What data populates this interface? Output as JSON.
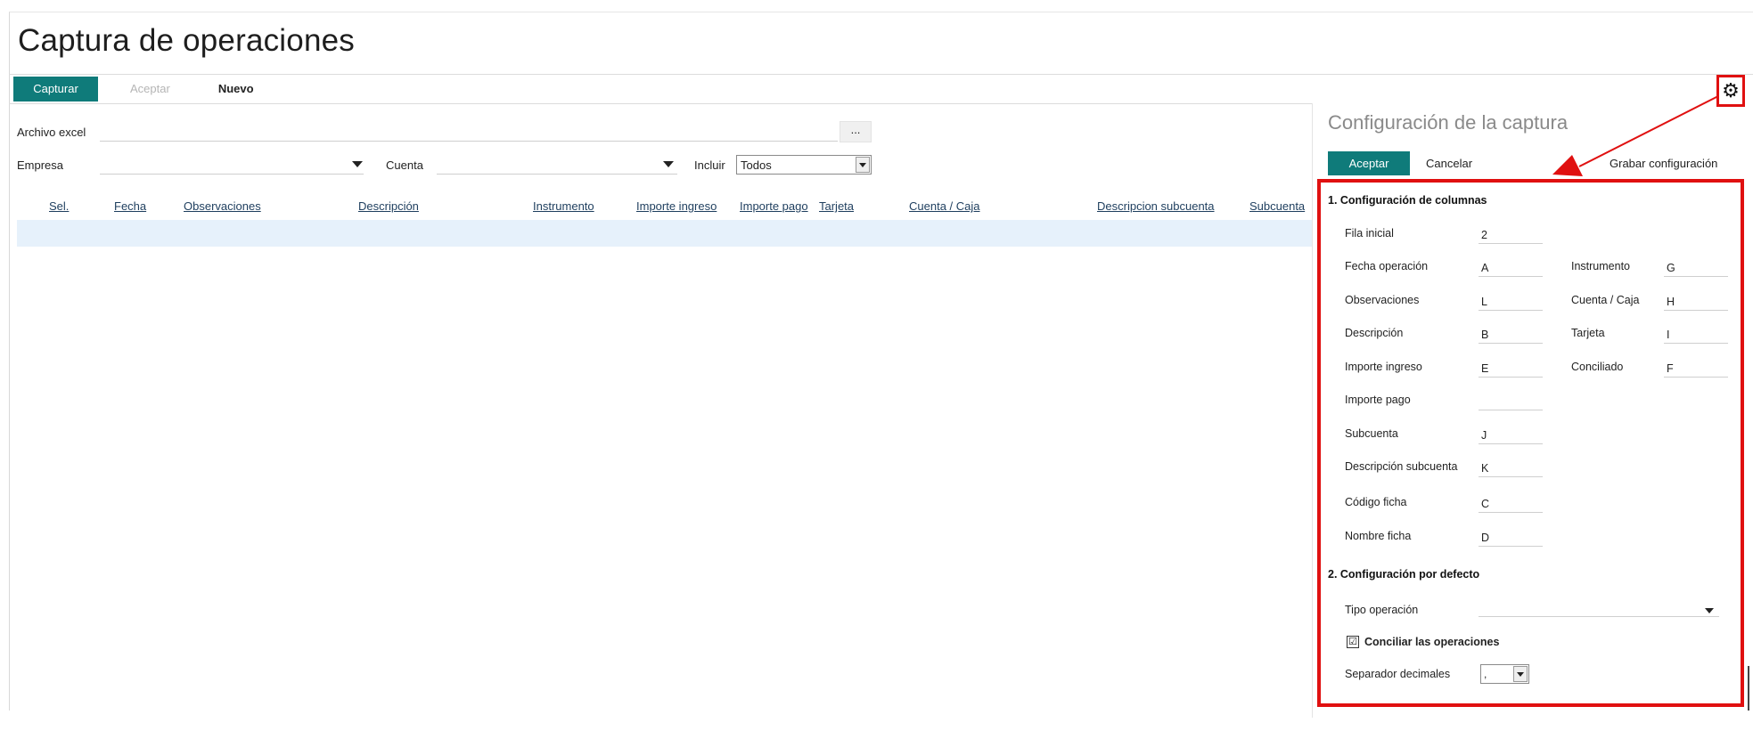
{
  "page": {
    "title": "Captura de operaciones"
  },
  "toolbar": {
    "capture_label": "Capturar",
    "accept_label": "Aceptar",
    "new_label": "Nuevo"
  },
  "form": {
    "excel_label": "Archivo excel",
    "excel_value": "",
    "browse_label": "...",
    "company_label": "Empresa",
    "company_value": "",
    "account_label": "Cuenta",
    "account_value": "",
    "include_label": "Incluir",
    "include_value": "Todos"
  },
  "grid": {
    "columns": [
      "Sel.",
      "Fecha",
      "Observaciones",
      "Descripción",
      "Instrumento",
      "Importe ingreso",
      "Importe pago",
      "Tarjeta",
      "Cuenta / Caja",
      "Descripcion subcuenta",
      "Subcuenta"
    ]
  },
  "icons": {
    "settings": "gear-icon"
  },
  "colors": {
    "accent": "#0f7b7a",
    "highlight": "#e01010",
    "row_selected": "#e6f1fb"
  },
  "panel": {
    "title": "Configuración de la captura",
    "accept_label": "Aceptar",
    "cancel_label": "Cancelar",
    "save_label": "Grabar configuración",
    "section1_title": "1. Configuración de columnas",
    "section2_title": "2. Configuración por defecto",
    "fields_left": [
      {
        "label": "Fila inicial",
        "value": "2"
      },
      {
        "label": "Fecha operación",
        "value": "A"
      },
      {
        "label": "Observaciones",
        "value": "L"
      },
      {
        "label": "Descripción",
        "value": "B"
      },
      {
        "label": "Importe ingreso",
        "value": "E"
      },
      {
        "label": "Importe pago",
        "value": ""
      },
      {
        "label": "Subcuenta",
        "value": "J"
      },
      {
        "label": "Descripción subcuenta",
        "value": "K"
      },
      {
        "label": "Código ficha",
        "value": "C"
      },
      {
        "label": "Nombre ficha",
        "value": "D"
      }
    ],
    "fields_right": [
      {
        "label": "Instrumento",
        "value": "G"
      },
      {
        "label": "Cuenta / Caja",
        "value": "H"
      },
      {
        "label": "Tarjeta",
        "value": "I"
      },
      {
        "label": "Conciliado",
        "value": "F"
      }
    ],
    "operation_type_label": "Tipo operación",
    "operation_type_value": "",
    "reconcile_label": "Conciliar las operaciones",
    "reconcile_checked": "☑",
    "decimal_sep_label": "Separador decimales",
    "decimal_sep_value": ","
  }
}
